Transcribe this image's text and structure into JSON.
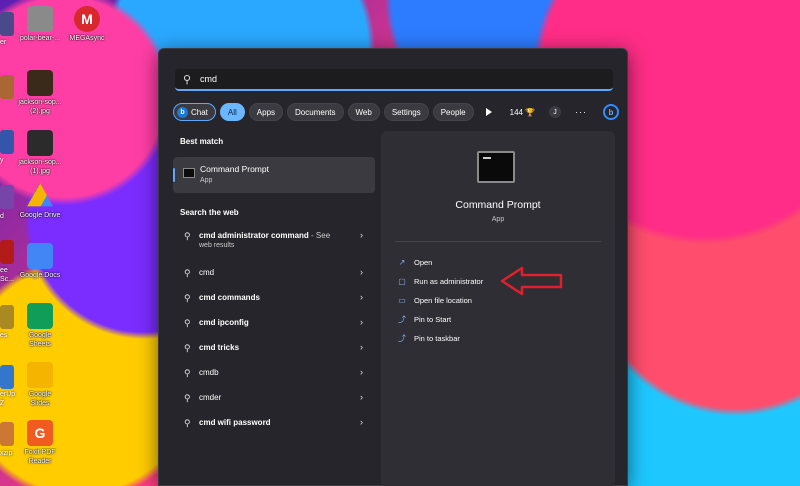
{
  "desktop": {
    "col2": [
      {
        "label": "polar-bear-...",
        "color": "#777"
      },
      {
        "label": "jackson-sop...\n(2).jpg",
        "color": "#553"
      },
      {
        "label": "jackson-sop...\n(1).jpg",
        "color": "#444"
      },
      {
        "label": "Google Drive",
        "color": "#1fa463"
      },
      {
        "label": "Google Docs",
        "color": "#4285f4"
      },
      {
        "label": "Google\nSheets",
        "color": "#0f9d58"
      },
      {
        "label": "Google\nSlides",
        "color": "#f4b400"
      },
      {
        "label": "Foxit PDF\nReader",
        "color": "#ef5b21"
      }
    ],
    "col3": [
      {
        "label": "MEGAsync",
        "color": "#d9272e"
      }
    ],
    "edge": [
      {
        "label": "er",
        "color": "#4a4a8a"
      },
      {
        "label": "r",
        "color": "#aa6633"
      },
      {
        "label": "y",
        "color": "#3355aa"
      },
      {
        "label": "d",
        "color": "#7744aa"
      },
      {
        "label": "ee\nSc...",
        "color": "#b31b1b"
      },
      {
        "label": "es",
        "color": "#aa8822"
      },
      {
        "label": "erUp\n2",
        "color": "#3377cc"
      },
      {
        "label": "xzip",
        "color": "#cc7733"
      }
    ]
  },
  "search": {
    "query": "cmd"
  },
  "chips": {
    "chat": "Chat",
    "all": "All",
    "apps": "Apps",
    "documents": "Documents",
    "web": "Web",
    "settings": "Settings",
    "people": "People",
    "points": "144",
    "avatar": "J",
    "bing": "b"
  },
  "left": {
    "best_match": "Best match",
    "best": {
      "title": "Command Prompt",
      "subtitle": "App"
    },
    "search_web": "Search the web",
    "web_first": {
      "bold": "cmd administrator command",
      "rest": " - See",
      "sub": "web results"
    },
    "web_items": [
      "cmd",
      "cmd commands",
      "cmd ipconfig",
      "cmd tricks",
      "cmdb",
      "cmder",
      "cmd wifi password"
    ]
  },
  "right": {
    "title": "Command Prompt",
    "subtitle": "App",
    "actions": [
      "Open",
      "Run as administrator",
      "Open file location",
      "Pin to Start",
      "Pin to taskbar"
    ]
  },
  "colors": {
    "accent": "#60a5ff",
    "arrow": "#e0202a"
  }
}
